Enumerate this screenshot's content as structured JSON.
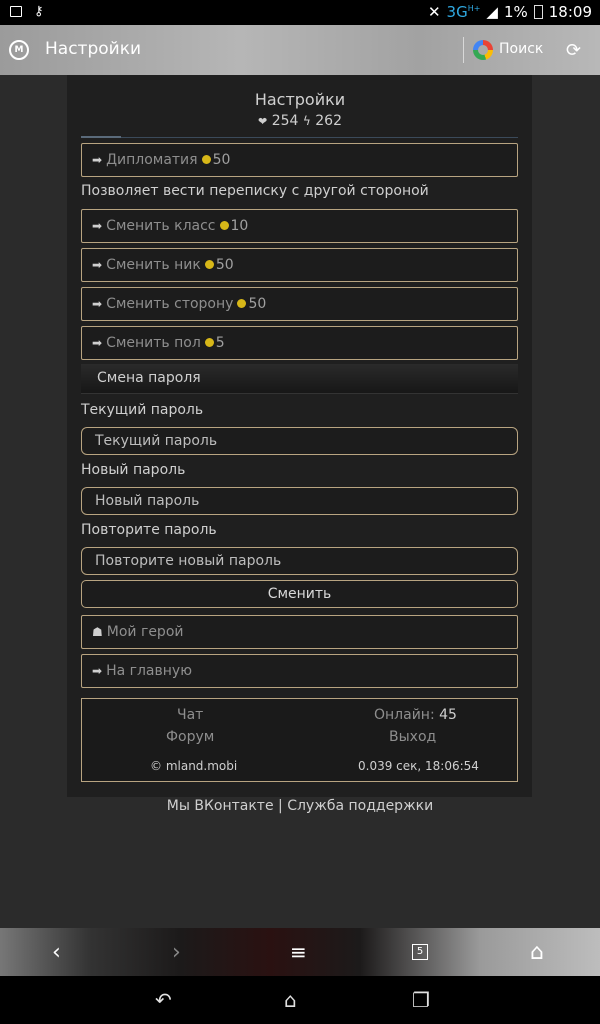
{
  "status_bar": {
    "network": "3G",
    "net_badge": "H+",
    "battery": "1%",
    "time": "18:09"
  },
  "browser": {
    "title": "Настройки",
    "search_label": "Поиск"
  },
  "page": {
    "title": "Настройки",
    "hp": "254",
    "energy": "262",
    "diplomacy": {
      "label": "Дипломатия",
      "price": "50"
    },
    "diplomacy_desc": "Позволяет вести переписку с другой стороной",
    "actions": [
      {
        "label": "Сменить класс",
        "price": "10"
      },
      {
        "label": "Сменить ник",
        "price": "50"
      },
      {
        "label": "Сменить сторону",
        "price": "50"
      },
      {
        "label": "Сменить пол",
        "price": "5"
      }
    ],
    "password_section": "Смена пароля",
    "current_label": "Текущий пароль",
    "current_placeholder": "Текущий пароль",
    "new_label": "Новый пароль",
    "new_placeholder": "Новый пароль",
    "repeat_label": "Повторите пароль",
    "repeat_placeholder": "Повторите новый пароль",
    "submit": "Сменить",
    "my_hero": "Мой герой",
    "home": "На главную"
  },
  "footer": {
    "chat": "Чат",
    "online_label": "Онлайн:",
    "online_count": "45",
    "forum": "Форум",
    "exit": "Выход",
    "copyright": "© mland.mobi",
    "timing": "0.039 сек, 18:06:54",
    "vk": "Мы ВКонтакте",
    "separator": " | ",
    "support": "Служба поддержки"
  },
  "nav": {
    "tab_count": "5"
  }
}
